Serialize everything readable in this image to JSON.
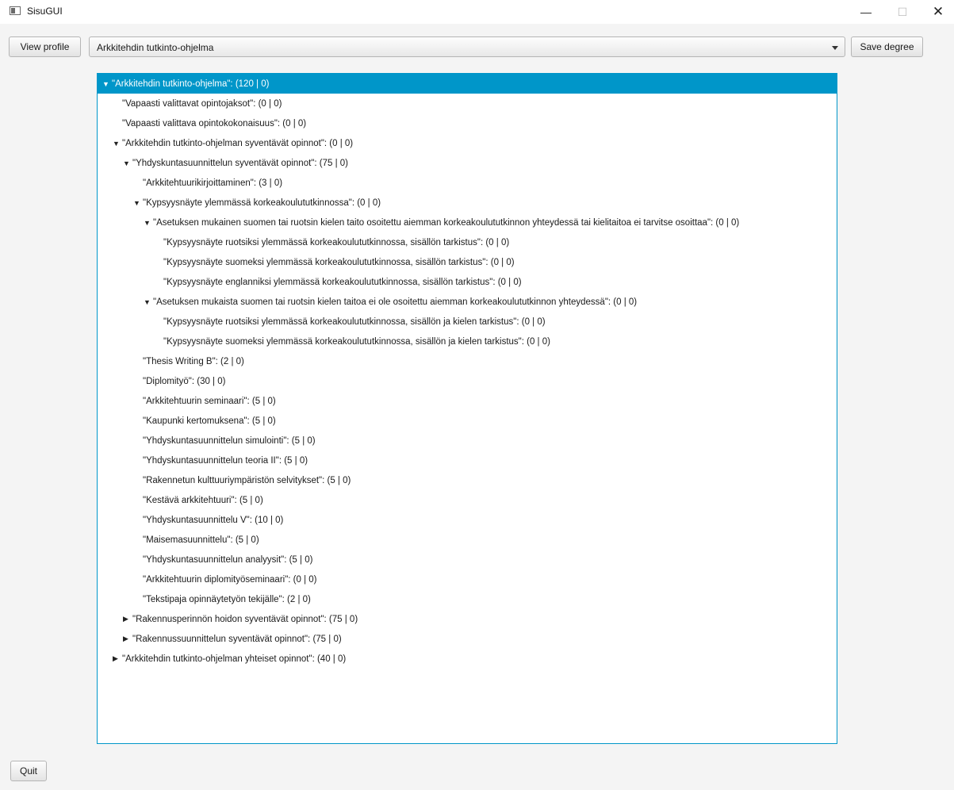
{
  "window": {
    "title": "SisuGUI"
  },
  "toolbar": {
    "view_profile_label": "View profile",
    "program_select_value": "Arkkitehdin tutkinto-ohjelma",
    "save_degree_label": "Save degree"
  },
  "footer": {
    "quit_label": "Quit"
  },
  "colors": {
    "selection": "#0096c9",
    "tree_border": "#0096c9",
    "background": "#f4f4f4"
  },
  "tree": {
    "nodes": [
      {
        "label": "\"Arkkitehdin tutkinto-ohjelma\": (120 | 0)",
        "depth": 0,
        "expander": "expanded",
        "selected": true
      },
      {
        "label": "\"Vapaasti valittavat opintojaksot\": (0 | 0)",
        "depth": 1,
        "expander": "leaf"
      },
      {
        "label": "\"Vapaasti valittava opintokokonaisuus\": (0 | 0)",
        "depth": 1,
        "expander": "leaf"
      },
      {
        "label": "\"Arkkitehdin tutkinto-ohjelman syventävät opinnot\": (0 | 0)",
        "depth": 1,
        "expander": "expanded"
      },
      {
        "label": "\"Yhdyskuntasuunnittelun syventävät opinnot\": (75 | 0)",
        "depth": 2,
        "expander": "expanded"
      },
      {
        "label": "\"Arkkitehtuurikirjoittaminen\": (3 | 0)",
        "depth": 3,
        "expander": "leaf"
      },
      {
        "label": "\"Kypsyysnäyte ylemmässä korkeakoulututkinnossa\": (0 | 0)",
        "depth": 3,
        "expander": "expanded"
      },
      {
        "label": "\"Asetuksen mukainen suomen tai ruotsin kielen taito osoitettu aiemman korkeakoulututkinnon yhteydessä tai kielitaitoa ei tarvitse osoittaa\": (0 | 0)",
        "depth": 4,
        "expander": "expanded"
      },
      {
        "label": "\"Kypsyysnäyte ruotsiksi ylemmässä korkeakoulututkinnossa, sisällön tarkistus\": (0 | 0)",
        "depth": 5,
        "expander": "leaf"
      },
      {
        "label": "\"Kypsyysnäyte suomeksi ylemmässä korkeakoulututkinnossa, sisällön tarkistus\": (0 | 0)",
        "depth": 5,
        "expander": "leaf"
      },
      {
        "label": "\"Kypsyysnäyte englanniksi ylemmässä korkeakoulututkinnossa, sisällön tarkistus\": (0 | 0)",
        "depth": 5,
        "expander": "leaf"
      },
      {
        "label": "\"Asetuksen mukaista suomen tai ruotsin kielen taitoa ei ole osoitettu aiemman korkeakoulututkinnon yhteydessä\": (0 | 0)",
        "depth": 4,
        "expander": "expanded"
      },
      {
        "label": "\"Kypsyysnäyte ruotsiksi ylemmässä korkeakoulututkinnossa, sisällön ja kielen tarkistus\": (0 | 0)",
        "depth": 5,
        "expander": "leaf"
      },
      {
        "label": "\"Kypsyysnäyte suomeksi ylemmässä korkeakoulututkinnossa, sisällön ja kielen tarkistus\": (0 | 0)",
        "depth": 5,
        "expander": "leaf"
      },
      {
        "label": "\"Thesis Writing B\": (2 | 0)",
        "depth": 3,
        "expander": "leaf"
      },
      {
        "label": "\"Diplomityö\": (30 | 0)",
        "depth": 3,
        "expander": "leaf"
      },
      {
        "label": "\"Arkkitehtuurin seminaari\": (5 | 0)",
        "depth": 3,
        "expander": "leaf"
      },
      {
        "label": "\"Kaupunki kertomuksena\": (5 | 0)",
        "depth": 3,
        "expander": "leaf"
      },
      {
        "label": "\"Yhdyskuntasuunnittelun simulointi\": (5 | 0)",
        "depth": 3,
        "expander": "leaf"
      },
      {
        "label": "\"Yhdyskuntasuunnittelun teoria II\": (5 | 0)",
        "depth": 3,
        "expander": "leaf"
      },
      {
        "label": "\"Rakennetun kulttuuriympäristön selvitykset\": (5 | 0)",
        "depth": 3,
        "expander": "leaf"
      },
      {
        "label": "\"Kestävä arkkitehtuuri\": (5 | 0)",
        "depth": 3,
        "expander": "leaf"
      },
      {
        "label": "\"Yhdyskuntasuunnittelu V\": (10 | 0)",
        "depth": 3,
        "expander": "leaf"
      },
      {
        "label": "\"Maisemasuunnittelu\": (5 | 0)",
        "depth": 3,
        "expander": "leaf"
      },
      {
        "label": "\"Yhdyskuntasuunnittelun analyysit\": (5 | 0)",
        "depth": 3,
        "expander": "leaf"
      },
      {
        "label": "\"Arkkitehtuurin diplomityöseminaari\": (0 | 0)",
        "depth": 3,
        "expander": "leaf"
      },
      {
        "label": "\"Tekstipaja opinnäytetyön tekijälle\": (2 | 0)",
        "depth": 3,
        "expander": "leaf"
      },
      {
        "label": "\"Rakennusperinnön hoidon syventävät opinnot\": (75 | 0)",
        "depth": 2,
        "expander": "collapsed"
      },
      {
        "label": "\"Rakennussuunnittelun syventävät opinnot\": (75 | 0)",
        "depth": 2,
        "expander": "collapsed"
      },
      {
        "label": "\"Arkkitehdin tutkinto-ohjelman yhteiset opinnot\": (40 | 0)",
        "depth": 1,
        "expander": "collapsed"
      }
    ]
  }
}
